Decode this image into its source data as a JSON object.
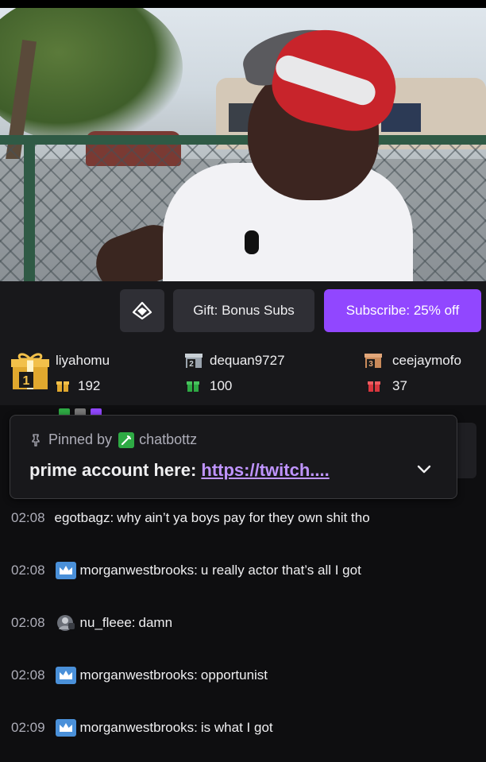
{
  "actions": {
    "gift_label": "Gift: Bonus Subs",
    "subscribe_label": "Subscribe: 25% off"
  },
  "leaderboard": [
    {
      "name": "liyahomu",
      "count": "192",
      "rank": "1"
    },
    {
      "name": "dequan9727",
      "count": "100",
      "rank": "2"
    },
    {
      "name": "ceejaymofo",
      "count": "37",
      "rank": "3"
    }
  ],
  "pinned": {
    "prefix": "Pinned by",
    "by_user": "chatbottz",
    "message": "prime account here: ",
    "link": "https://twitch...."
  },
  "chat": [
    {
      "time": "02:08",
      "badge": "none",
      "user": "egotbagz",
      "user_color": "#efeff1",
      "text": "why ain’t ya boys pay for they own shit tho"
    },
    {
      "time": "02:08",
      "badge": "crown",
      "user": "morganwestbrooks",
      "user_color": "#efeff1",
      "text": "u really actor that’s all I got"
    },
    {
      "time": "02:08",
      "badge": "avatar",
      "user": "nu_fleee",
      "user_color": "#efeff1",
      "text": "damn"
    },
    {
      "time": "02:08",
      "badge": "crown",
      "user": "morganwestbrooks",
      "user_color": "#efeff1",
      "text": "opportunist"
    },
    {
      "time": "02:09",
      "badge": "crown",
      "user": "morganwestbrooks",
      "user_color": "#efeff1",
      "text": "is what I got"
    }
  ],
  "colors": {
    "accent": "#9147ff",
    "link": "#bf94ff",
    "crown_badge": "#4a90d9",
    "bot_badge": "#2eaa44"
  }
}
